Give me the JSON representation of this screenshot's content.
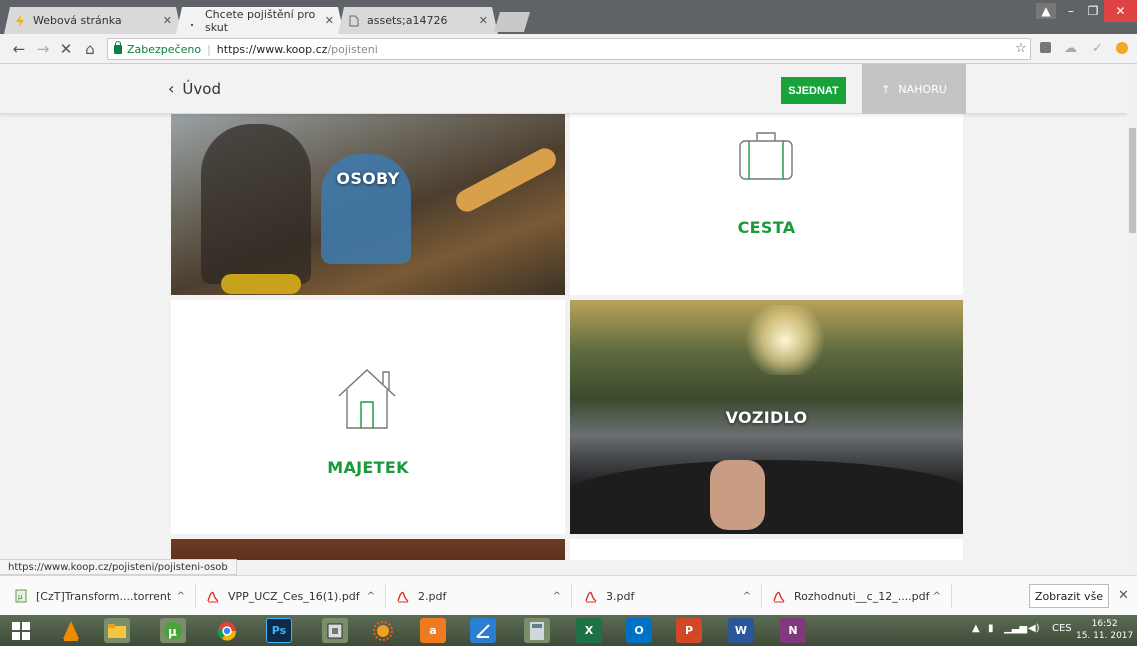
{
  "browser": {
    "tabs": [
      {
        "label": "Webová stránka",
        "active": false
      },
      {
        "label": "Chcete pojištění pro skut",
        "active": true
      },
      {
        "label": "assets;a14726",
        "active": false
      }
    ],
    "address": {
      "secure_label": "Zabezpečeno",
      "url_host": "https://www.koop.cz",
      "url_path": "/pojisteni"
    }
  },
  "page": {
    "back_label": "Úvod",
    "sjednat_label": "SJEDNAT",
    "nahoru_label": "NAHORU",
    "tiles": {
      "osoby": "OSOBY",
      "cesta": "CESTA",
      "majetek": "MAJETEK",
      "vozidlo": "VOZIDLO"
    }
  },
  "status_url": "https://www.koop.cz/pojisteni/pojisteni-osob",
  "downloads": {
    "items": [
      "[CzT]Transform....torrent",
      "VPP_UCZ_Ces_16(1).pdf",
      "2.pdf",
      "3.pdf",
      "Rozhodnuti__c_12_....pdf"
    ],
    "show_all_label": "Zobrazit vše"
  },
  "taskbar": {
    "apps": [
      "Ps",
      "X",
      "O",
      "P",
      "W",
      "N"
    ],
    "lang": "CES",
    "time": "16:52",
    "date": "15. 11. 2017"
  },
  "colors": {
    "brand_green": "#17a33a",
    "label_green": "#1a9a3a",
    "nahoru_gray": "#c4c4c4"
  }
}
